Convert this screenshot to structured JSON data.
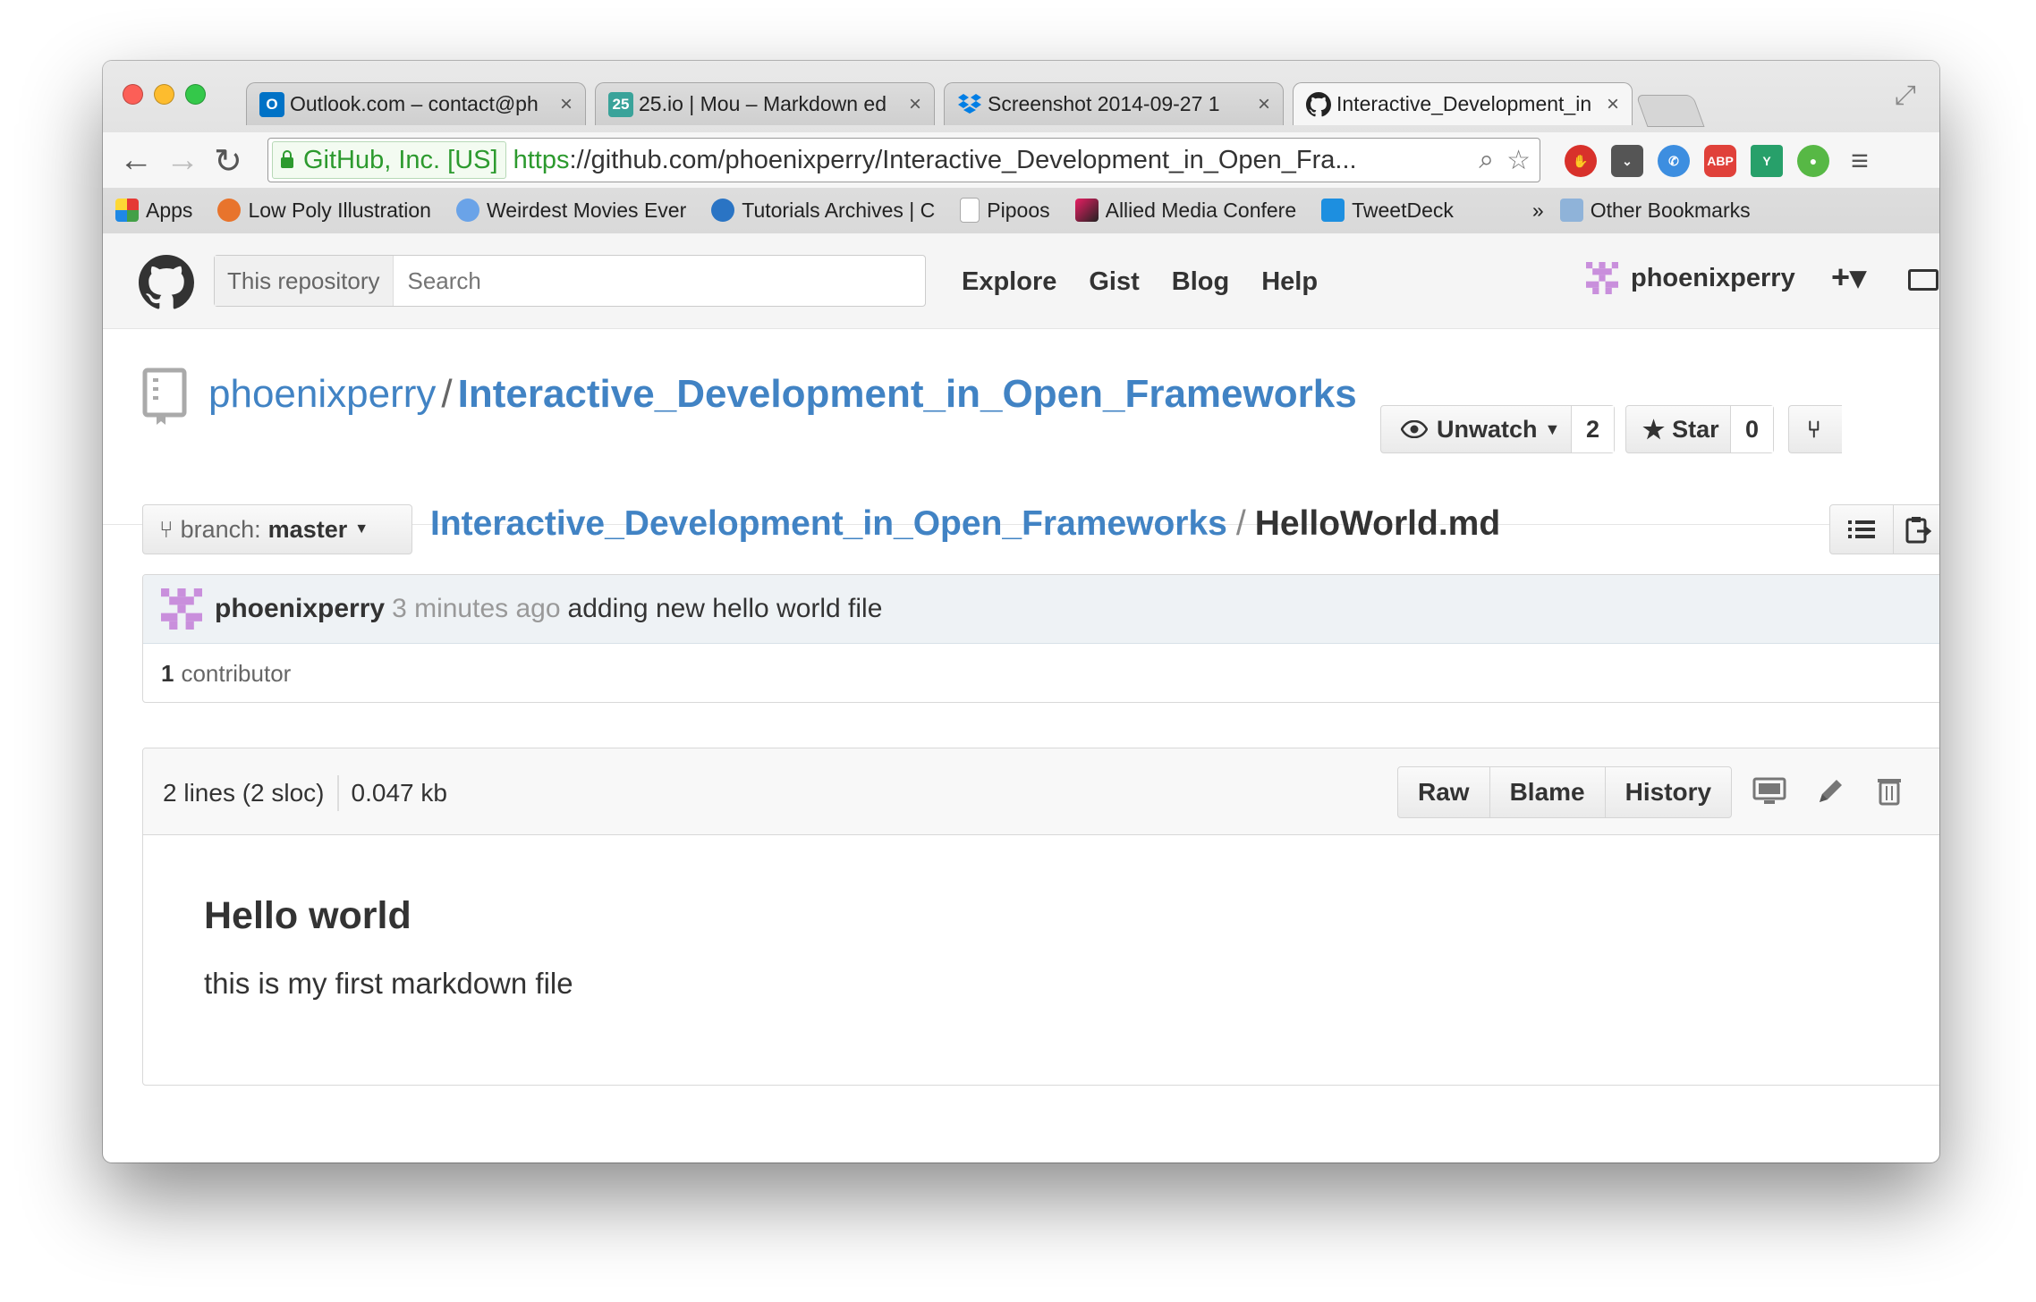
{
  "browser": {
    "tabs": [
      {
        "title": "Outlook.com – contact@ph",
        "icon": "outlook-icon",
        "color": "#0072c6",
        "glyph": "O"
      },
      {
        "title": "25.io | Mou – Markdown ed",
        "icon": "mou-icon",
        "color": "#3aa39a",
        "glyph": "25"
      },
      {
        "title": "Screenshot 2014-09-27 1",
        "icon": "dropbox-icon",
        "color": "#007ee5",
        "glyph": ""
      },
      {
        "title": "Interactive_Development_in",
        "icon": "github-icon",
        "color": "#222222",
        "glyph": ""
      }
    ],
    "ev_label": "GitHub, Inc. [US]",
    "url_scheme": "https",
    "url_rest": "://github.com/phoenixperry/Interactive_Development_in_Open_Fra...",
    "bookmarks": [
      {
        "label": "Apps",
        "icon": "apps-grid-icon"
      },
      {
        "label": "Low Poly Illustration",
        "icon": "lowpoly-icon"
      },
      {
        "label": "Weirdest Movies Ever",
        "icon": "f-icon"
      },
      {
        "label": "Tutorials Archives | C",
        "icon": "drop-icon"
      },
      {
        "label": "Pipoos",
        "icon": "page-icon"
      },
      {
        "label": "Allied Media Confere",
        "icon": "amc-icon"
      },
      {
        "label": "TweetDeck",
        "icon": "tweetdeck-icon"
      }
    ],
    "bookmarks_more": "»",
    "other_bookmarks": "Other Bookmarks"
  },
  "github": {
    "search_scope": "This repository",
    "search_placeholder": "Search",
    "nav": [
      "Explore",
      "Gist",
      "Blog",
      "Help"
    ],
    "username": "phoenixperry",
    "plus": "+▾"
  },
  "repo": {
    "owner": "phoenixperry",
    "sep": "/",
    "name": "Interactive_Development_in_Open_Frameworks",
    "unwatch_label": "Unwatch",
    "watch_count": "2",
    "star_label": "Star",
    "star_count": "0"
  },
  "filenav": {
    "branch_prefix": "branch:",
    "branch": "master",
    "crumb_repo": "Interactive_Development_in_Open_Frameworks",
    "sep": "/",
    "file": "HelloWorld.md"
  },
  "commit": {
    "author": "phoenixperry",
    "time": "3 minutes ago",
    "message": "adding new hello world file",
    "contributors_count": "1",
    "contributors_label": "contributor"
  },
  "file": {
    "lines": "2 lines (2 sloc)",
    "size": "0.047 kb",
    "buttons": [
      "Raw",
      "Blame",
      "History"
    ]
  },
  "readme": {
    "heading": "Hello world",
    "body": "this is my first markdown file"
  }
}
